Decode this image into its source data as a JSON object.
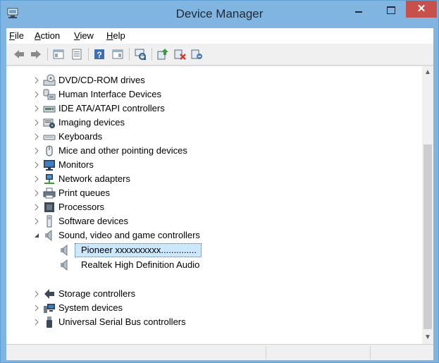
{
  "window": {
    "title": "Device Manager"
  },
  "menu": [
    {
      "label": "File",
      "mnemonic": "F",
      "rest": "ile"
    },
    {
      "label": "Action",
      "mnemonic": "A",
      "rest": "ction"
    },
    {
      "label": "View",
      "mnemonic": "V",
      "rest": "iew"
    },
    {
      "label": "Help",
      "mnemonic": "H",
      "rest": "elp"
    }
  ],
  "toolbar_icons": [
    "back-arrow-icon",
    "forward-arrow-icon",
    "properties-icon",
    "show-hide-console-tree-icon",
    "help-icon",
    "show-hide-action-pane-icon",
    "scan-hardware-icon",
    "update-driver-icon",
    "uninstall-device-icon",
    "disable-device-icon"
  ],
  "tree": {
    "nodes": [
      {
        "label": "DVD/CD-ROM drives",
        "icon": "dvd-drive-icon",
        "level": 0,
        "expanded": false
      },
      {
        "label": "Human Interface Devices",
        "icon": "hid-icon",
        "level": 0,
        "expanded": false
      },
      {
        "label": "IDE ATA/ATAPI controllers",
        "icon": "ide-controller-icon",
        "level": 0,
        "expanded": false
      },
      {
        "label": "Imaging devices",
        "icon": "camera-icon",
        "level": 0,
        "expanded": false
      },
      {
        "label": "Keyboards",
        "icon": "keyboard-icon",
        "level": 0,
        "expanded": false
      },
      {
        "label": "Mice and other pointing devices",
        "icon": "mouse-icon",
        "level": 0,
        "expanded": false
      },
      {
        "label": "Monitors",
        "icon": "monitor-icon",
        "level": 0,
        "expanded": false
      },
      {
        "label": "Network adapters",
        "icon": "network-adapter-icon",
        "level": 0,
        "expanded": false
      },
      {
        "label": "Print queues",
        "icon": "printer-icon",
        "level": 0,
        "expanded": false
      },
      {
        "label": "Processors",
        "icon": "processor-icon",
        "level": 0,
        "expanded": false
      },
      {
        "label": "Software devices",
        "icon": "software-device-icon",
        "level": 0,
        "expanded": false
      },
      {
        "label": "Sound, video and game controllers",
        "icon": "speaker-icon",
        "level": 0,
        "expanded": true
      },
      {
        "label": "Pioneer xxxxxxxxxx..............",
        "icon": "speaker-icon",
        "level": 1,
        "selected": true
      },
      {
        "label": "Realtek High Definition Audio",
        "icon": "speaker-icon",
        "level": 1
      },
      {
        "label": "Storage controllers",
        "icon": "storage-controller-icon",
        "level": 0,
        "expanded": false
      },
      {
        "label": "System devices",
        "icon": "system-devices-icon",
        "level": 0,
        "expanded": false
      },
      {
        "label": "Universal Serial Bus controllers",
        "icon": "usb-icon",
        "level": 0,
        "expanded": false
      }
    ]
  },
  "colors": {
    "titlebar": "#7fb5e0",
    "close": "#c7504a",
    "selection": "#cce8ff"
  }
}
